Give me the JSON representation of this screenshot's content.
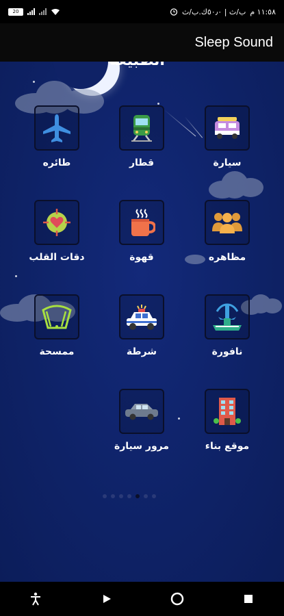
{
  "status_bar": {
    "time": "١١:٥٨ م",
    "carrier_text": "ب/ث | ٥٠٫٠ك.ب/ث",
    "battery": "20"
  },
  "app_bar": {
    "title": "Sleep Sound"
  },
  "header_partial_text": "الطبيعة",
  "tiles": [
    {
      "label": "سيارة",
      "icon": "car-taxi-icon"
    },
    {
      "label": "قطار",
      "icon": "train-icon"
    },
    {
      "label": "طائره",
      "icon": "airplane-icon"
    },
    {
      "label": "مظاهره",
      "icon": "crowd-icon"
    },
    {
      "label": "قهوة",
      "icon": "coffee-icon"
    },
    {
      "label": "دقات القلب",
      "icon": "heart-target-icon"
    },
    {
      "label": "نافورة",
      "icon": "fountain-icon"
    },
    {
      "label": "شرطة",
      "icon": "police-car-icon"
    },
    {
      "label": "ممسحة",
      "icon": "wiper-icon"
    },
    {
      "label": "موقع بناء",
      "icon": "construction-building-icon"
    },
    {
      "label": "مرور سيارة",
      "icon": "passing-car-icon"
    }
  ],
  "page_indicator": {
    "count": 7,
    "active_index": 4
  },
  "colors": {
    "background": "#0f2266",
    "bar": "#000000"
  }
}
